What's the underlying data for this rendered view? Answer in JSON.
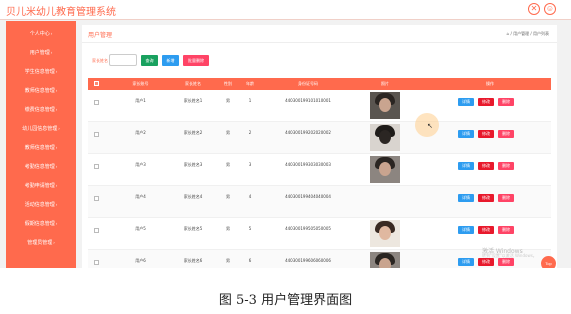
{
  "app": {
    "title": "贝儿米幼儿教育管理系统",
    "close_glyph": "✕",
    "user_glyph": "☺"
  },
  "sidebar": {
    "items": [
      {
        "label": "个人中心",
        "chev": "›"
      },
      {
        "label": "用户管理",
        "chev": "›"
      },
      {
        "label": "学生信息管理",
        "chev": "›"
      },
      {
        "label": "教师信息管理",
        "chev": "›"
      },
      {
        "label": "缴费信息管理",
        "chev": "›"
      },
      {
        "label": "幼儿园信息管理",
        "chev": "›"
      },
      {
        "label": "教师信息管理",
        "chev": "›"
      },
      {
        "label": "考勤信息管理",
        "chev": "›"
      },
      {
        "label": "考勤申请管理",
        "chev": "›"
      },
      {
        "label": "活动信息管理",
        "chev": "›"
      },
      {
        "label": "假期信息管理",
        "chev": "›"
      },
      {
        "label": "管理员管理",
        "chev": "›"
      }
    ]
  },
  "panel": {
    "title": "用户管理",
    "breadcrumb": "⌂ / 用户管理 / 用户列表"
  },
  "search": {
    "label": "家长姓名",
    "value": "",
    "search_button": "查询",
    "add_button": "新增",
    "batch_delete_button": "批量删除"
  },
  "table": {
    "headers": [
      "",
      "家长账号",
      "家长姓名",
      "性别",
      "年龄",
      "身份证号码",
      "照片",
      "操作"
    ],
    "rows": [
      {
        "account": "用户1",
        "name": "家长姓名1",
        "gender": "男",
        "age": "1",
        "id_number": "440300199101010001",
        "photo": "dark"
      },
      {
        "account": "用户2",
        "name": "家长姓名2",
        "gender": "男",
        "age": "2",
        "id_number": "440300199202020002",
        "photo": "dark"
      },
      {
        "account": "用户3",
        "name": "家长姓名3",
        "gender": "男",
        "age": "3",
        "id_number": "440300199303030003",
        "photo": "mid"
      },
      {
        "account": "用户4",
        "name": "家长姓名4",
        "gender": "男",
        "age": "4",
        "id_number": "440300199404040004",
        "photo": "none"
      },
      {
        "account": "用户5",
        "name": "家长姓名5",
        "gender": "男",
        "age": "5",
        "id_number": "440300199505050005",
        "photo": "light"
      },
      {
        "account": "用户6",
        "name": "家长姓名6",
        "gender": "男",
        "age": "6",
        "id_number": "440300199606060006",
        "photo": "mid"
      }
    ],
    "row_actions": {
      "detail": "详情",
      "edit": "修改",
      "delete": "删除"
    }
  },
  "overlay": {
    "watermark_title": "激活 Windows",
    "watermark_sub": "转到\"设置\"以激活 Windows。",
    "fab_label": "Top"
  },
  "caption": "图 5-3 用户管理界面图",
  "colors": {
    "accent": "#ff6a4d",
    "search_button": "#19a15f",
    "add_button": "#2d9cf0",
    "delete_button": "#ff4466",
    "detail_button": "#2d9cf0",
    "edit_button": "#e8192c",
    "row_delete_button": "#ff4466"
  }
}
